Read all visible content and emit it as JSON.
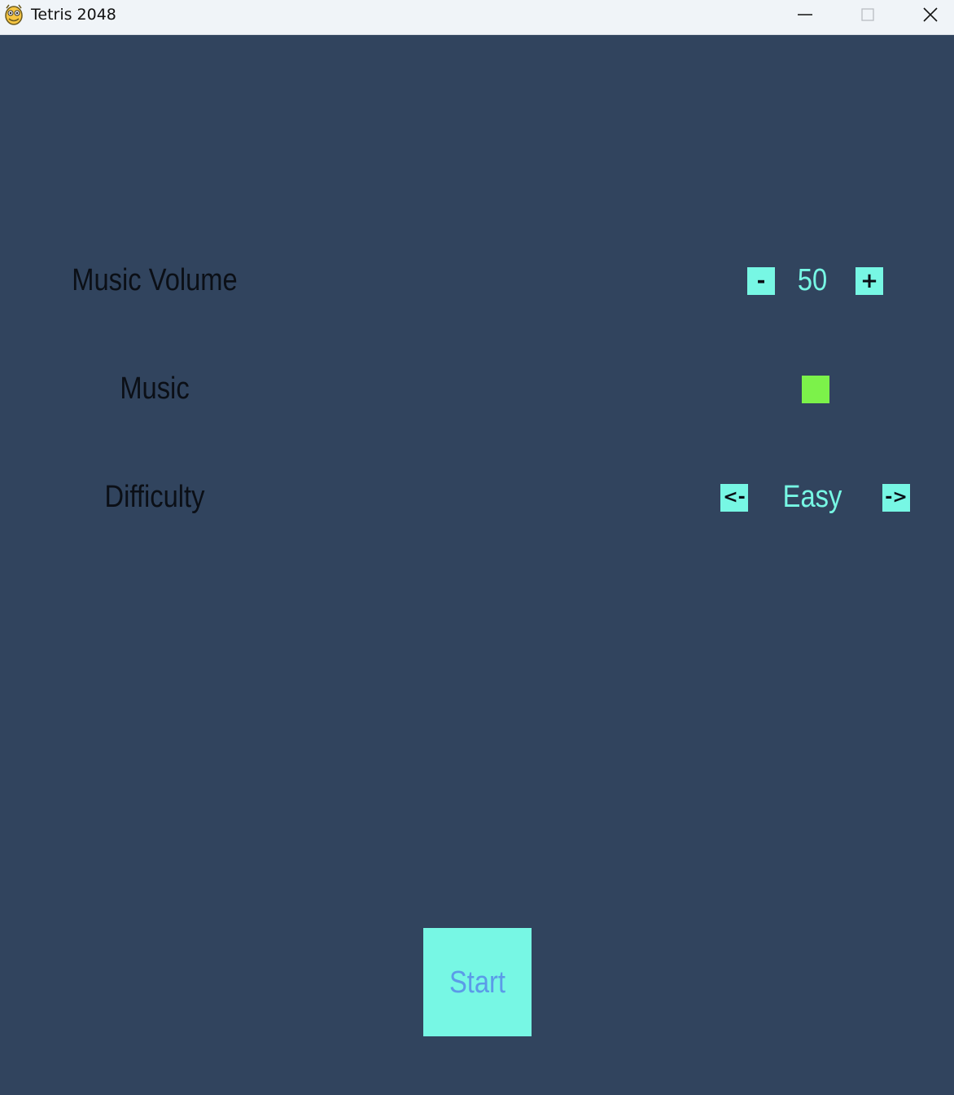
{
  "window": {
    "title": "Tetris 2048",
    "icon": "pygame-snake-icon",
    "controls": {
      "minimize_icon": "minimize-icon",
      "maximize_icon": "maximize-icon",
      "close_icon": "close-icon"
    }
  },
  "settings": {
    "music_volume": {
      "label": "Music Volume",
      "decrease_label": "-",
      "value": "50",
      "increase_label": "+"
    },
    "music": {
      "label": "Music",
      "toggle_state": "on",
      "toggle_color": "#7cf24a"
    },
    "difficulty": {
      "label": "Difficulty",
      "prev_label": "<-",
      "value": "Easy",
      "next_label": "->"
    }
  },
  "start_button": {
    "label": "Start"
  },
  "colors": {
    "background": "#31445e",
    "accent": "#77f7e4",
    "label_text": "#0b0f16",
    "start_text": "#5b9be8",
    "toggle_on": "#7cf24a"
  }
}
